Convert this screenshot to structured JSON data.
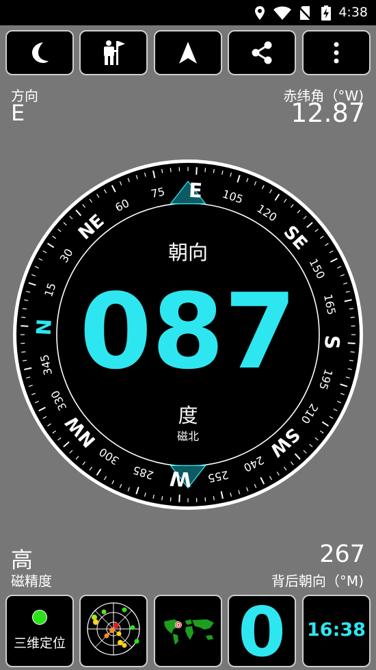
{
  "status_bar": {
    "time": "4:38"
  },
  "toolbar": {
    "icons": [
      "night-mode-moon-icon",
      "hiker-flag-icon",
      "navigation-arrow-icon",
      "share-icon",
      "more-vert-icon"
    ]
  },
  "readouts": {
    "direction_label": "方向",
    "direction_value": "E",
    "declination_label": "赤纬角（°W)",
    "declination_value": "12.87",
    "accuracy_value": "高",
    "accuracy_label": "磁精度",
    "back_bearing_value": "267",
    "back_bearing_label": "背后朝向（°M)"
  },
  "compass": {
    "heading_label": "朝向",
    "heading_value": "087",
    "unit_label": "度",
    "reference_label": "磁北",
    "heading_degrees": 87,
    "cardinals": [
      "N",
      "NE",
      "E",
      "SE",
      "S",
      "SW",
      "W",
      "NW"
    ],
    "degree_labels": [
      "15",
      "30",
      "60",
      "75",
      "105",
      "120",
      "150",
      "165",
      "195",
      "210",
      "240",
      "255",
      "285",
      "300",
      "330",
      "345"
    ],
    "accent_color": "#2ee6f0"
  },
  "bottom_bar": {
    "fix_status": "三维定位",
    "satellite_count": "0",
    "clock": "16:38",
    "icons": [
      "gps-fix-dot-icon",
      "satellite-sky-icon",
      "world-map-icon"
    ]
  }
}
